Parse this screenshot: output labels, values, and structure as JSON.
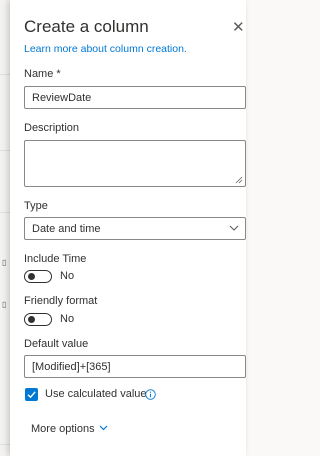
{
  "panel": {
    "title": "Create a column",
    "learn_more": "Learn more about column creation."
  },
  "fields": {
    "name": {
      "label": "Name *",
      "value": "ReviewDate"
    },
    "description": {
      "label": "Description",
      "value": ""
    },
    "type": {
      "label": "Type",
      "value": "Date and time"
    },
    "include_time": {
      "label": "Include Time",
      "state": "No",
      "on": false
    },
    "friendly_format": {
      "label": "Friendly format",
      "state": "No",
      "on": false
    },
    "default_value": {
      "label": "Default value",
      "value": "[Modified]+[365]"
    },
    "use_calculated": {
      "label": "Use calculated value",
      "checked": true
    }
  },
  "more_options": "More options",
  "icons": {
    "close": "close-icon",
    "type_dropdown": "chevron-down-icon",
    "info": "info-icon",
    "more_options": "chevron-down-icon",
    "checkbox": "checkmark-icon"
  },
  "colors": {
    "accent": "#0078d4",
    "text": "#323130",
    "border": "#8a8886"
  }
}
